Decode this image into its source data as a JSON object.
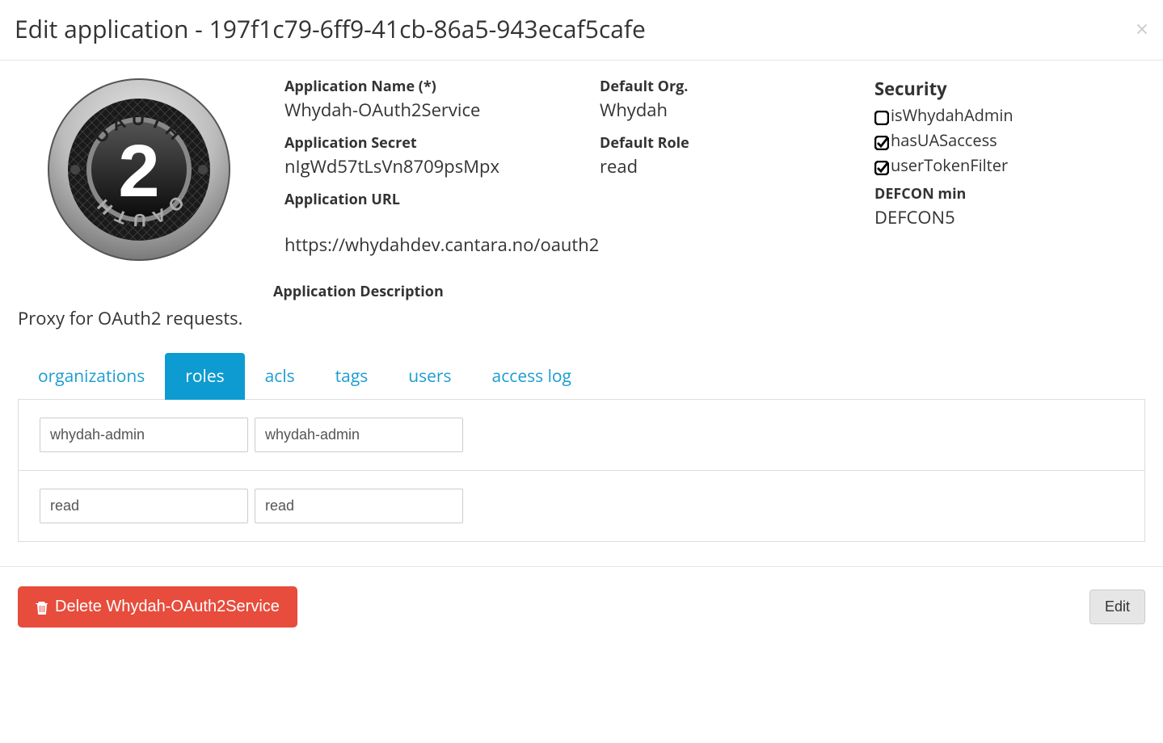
{
  "header": {
    "title": "Edit application - 197f1c79-6ff9-41cb-86a5-943ecaf5cafe"
  },
  "fields": {
    "appName_label": "Application Name (*)",
    "appName_value": "Whydah-OAuth2Service",
    "appSecret_label": "Application Secret",
    "appSecret_value": "nIgWd57tLsVn8709psMpx",
    "appUrl_label": "Application URL",
    "appUrl_value": "https://whydahdev.cantara.no/oauth2",
    "defaultOrg_label": "Default Org.",
    "defaultOrg_value": "Whydah",
    "defaultRole_label": "Default Role",
    "defaultRole_value": "read",
    "appDesc_label": "Application Description",
    "appDesc_value": "Proxy for OAuth2 requests."
  },
  "security": {
    "heading": "Security",
    "isWhydahAdmin_label": "isWhydahAdmin",
    "isWhydahAdmin_checked": false,
    "hasUASaccess_label": "hasUASaccess",
    "hasUASaccess_checked": true,
    "userTokenFilter_label": "userTokenFilter",
    "userTokenFilter_checked": true,
    "defcon_label": "DEFCON min",
    "defcon_value": "DEFCON5"
  },
  "tabs": {
    "organizations": "organizations",
    "roles": "roles",
    "acls": "acls",
    "tags": "tags",
    "users": "users",
    "access_log": "access log",
    "active": "roles"
  },
  "roles": [
    {
      "col1": "whydah-admin",
      "col2": "whydah-admin"
    },
    {
      "col1": "read",
      "col2": "read"
    }
  ],
  "footer": {
    "delete_label": "Delete Whydah-OAuth2Service",
    "edit_label": "Edit"
  }
}
